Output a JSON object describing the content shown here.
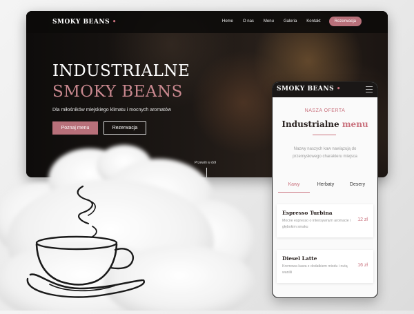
{
  "brand": {
    "name": "SMOKY BEANS",
    "dot": "•",
    "accent": "#c9717d"
  },
  "desktop": {
    "nav": {
      "links": [
        "Home",
        "O nas",
        "Menu",
        "Galeria",
        "Kontakt"
      ],
      "cta": "Rezerwacja"
    },
    "hero": {
      "title_line1": "INDUSTRIALNE",
      "title_line2": "SMOKY BEANS",
      "subtitle": "Dla miłośników miejskiego klimatu i mocnych aromatów",
      "primary_button": "Poznaj menu",
      "secondary_button": "Rezerwacja",
      "scroll_hint": "Przewiń w dół"
    }
  },
  "mobile": {
    "section_label": "NASZA OFERTA",
    "title_main": "Industrialne",
    "title_accent": "menu",
    "description": "Nazwy naszych kaw nawiązują do przemysłowego charakteru miejsca",
    "tabs": [
      "Kawy",
      "Herbaty",
      "Desery"
    ],
    "active_tab": "Kawy",
    "items": [
      {
        "name": "Espresso Turbina",
        "description": "Mocne espresso o intensywnym aromacie i głębokim smaku",
        "price": "12 zł"
      },
      {
        "name": "Diesel Latte",
        "description": "Kremowa kawa z dodatkiem miodu i nutą wanilii",
        "price": "16 zł"
      }
    ]
  },
  "icons": [
    "menu-icon",
    "coffee-cup-icon",
    "cloud-decoration"
  ]
}
